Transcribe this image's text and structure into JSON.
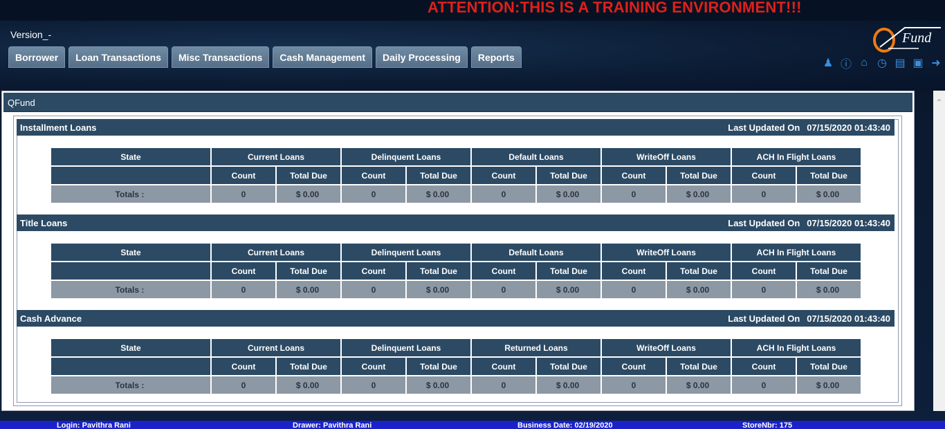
{
  "banner": "ATTENTION:THIS IS A TRAINING ENVIRONMENT!!!",
  "version": "Version_-",
  "logo_text": "Fund",
  "tabs": [
    "Borrower",
    "Loan Transactions",
    "Misc Transactions",
    "Cash Management",
    "Daily Processing",
    "Reports"
  ],
  "toolbar_icons": [
    "user-icon",
    "info-icon",
    "home-icon",
    "clock-icon",
    "list-icon",
    "lock-icon",
    "logout-icon"
  ],
  "panel_title": "QFund",
  "sections": [
    {
      "title": "Installment Loans",
      "updated_label": "Last Updated On",
      "updated_value": "07/15/2020 01:43:40",
      "state_header": "State",
      "groups": [
        "Current Loans",
        "Delinquent Loans",
        "Default Loans",
        "WriteOff Loans",
        "ACH In Flight Loans"
      ],
      "sub": [
        "Count",
        "Total Due"
      ],
      "totals_label": "Totals :",
      "totals": [
        "0",
        "$ 0.00",
        "0",
        "$ 0.00",
        "0",
        "$ 0.00",
        "0",
        "$ 0.00",
        "0",
        "$ 0.00"
      ]
    },
    {
      "title": "Title Loans",
      "updated_label": "Last Updated On",
      "updated_value": "07/15/2020 01:43:40",
      "state_header": "State",
      "groups": [
        "Current Loans",
        "Delinquent Loans",
        "Default Loans",
        "WriteOff Loans",
        "ACH In Flight Loans"
      ],
      "sub": [
        "Count",
        "Total Due"
      ],
      "totals_label": "Totals :",
      "totals": [
        "0",
        "$ 0.00",
        "0",
        "$ 0.00",
        "0",
        "$ 0.00",
        "0",
        "$ 0.00",
        "0",
        "$ 0.00"
      ]
    },
    {
      "title": "Cash Advance",
      "updated_label": "Last Updated On",
      "updated_value": "07/15/2020 01:43:40",
      "state_header": "State",
      "groups": [
        "Current Loans",
        "Delinquent Loans",
        "Returned Loans",
        "WriteOff Loans",
        "ACH In Flight Loans"
      ],
      "sub": [
        "Count",
        "Total Due"
      ],
      "totals_label": "Totals :",
      "totals": [
        "0",
        "$ 0.00",
        "0",
        "$ 0.00",
        "0",
        "$ 0.00",
        "0",
        "$ 0.00",
        "0",
        "$ 0.00"
      ]
    }
  ],
  "footer": {
    "login": "Login: Pavithra Rani",
    "drawer": "Drawer: Pavithra Rani",
    "business_date": "Business Date: 02/19/2020",
    "store": "StoreNbr: 175"
  }
}
